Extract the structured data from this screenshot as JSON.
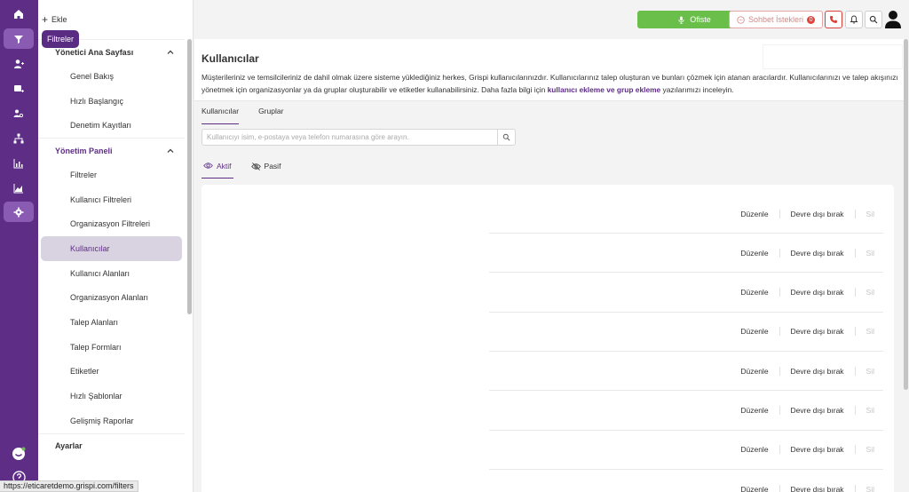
{
  "rail": {
    "tooltip": "Filtreler",
    "icons": [
      "home-icon",
      "filter-icon",
      "user-add-icon",
      "ticket-add-icon",
      "users-search-icon",
      "org-chart-icon",
      "chart-icon",
      "report-icon",
      "settings-icon",
      "chat-bot-icon",
      "help-icon"
    ]
  },
  "status_url": "https://eticaretdemo.grispi.com/filters",
  "nav": {
    "add_label": "Ekle",
    "sections": [
      {
        "title": "Yönetici Ana Sayfası",
        "items": [
          "Genel Bakış",
          "Hızlı Başlangıç",
          "Denetim Kayıtları"
        ]
      },
      {
        "title": "Yönetim Paneli",
        "items": [
          "Filtreler",
          "Kullanıcı Filtreleri",
          "Organizasyon Filtreleri",
          "Kullanıcılar",
          "Kullanıcı Alanları",
          "Organizasyon Alanları",
          "Talep Alanları",
          "Talep Formları",
          "Etiketler",
          "Hızlı Şablonlar",
          "Gelişmiş Raporlar"
        ]
      },
      {
        "title": "Ayarlar",
        "items": []
      }
    ],
    "active_item": "Kullanıcılar"
  },
  "topbar": {
    "ofiste_label": "Ofiste",
    "sohbet_label": "Sohbet İstekleri",
    "sohbet_count": "0"
  },
  "main": {
    "title": "Kullanıcılar",
    "desc_part1": "Müşterileriniz ve temsilcileriniz de dahil olmak üzere sisteme yüklediğiniz herkes, Grispi kullanıcılarınızdır. Kullanıcılarınız talep oluşturan ve bunları çözmek için atanan aracılardır. Kullanıcılarınızı ve talep akışınızı yönetmek için organizasyonlar ya da gruplar oluşturabilir ve etiketler kullanabilirsiniz. Daha fazla bilgi için ",
    "desc_link1": "kullanıcı ekleme",
    "desc_mid": " ve ",
    "desc_link2": "grup ekleme",
    "desc_end": " yazılarımızı inceleyin.",
    "tabs": [
      "Kullanıcılar",
      "Gruplar"
    ],
    "search_placeholder": "Kullanıcıyı isim, e-postaya veya telefon numarasına göre arayın.",
    "subtabs": [
      "Aktif",
      "Pasif"
    ],
    "row_actions": {
      "edit": "Düzenle",
      "disable": "Devre dışı bırak",
      "delete": "Sil"
    },
    "row_count": 8
  }
}
